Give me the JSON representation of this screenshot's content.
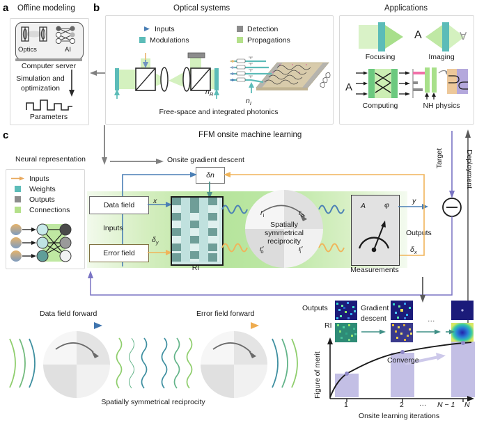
{
  "panels": {
    "a": {
      "letter": "a",
      "title": "Offline modeling",
      "optics_label": "Optics",
      "ai_label": "AI",
      "server_label": "Computer server",
      "sim_line1": "Simulation and",
      "sim_line2": "optimization",
      "parameters_label": "Parameters"
    },
    "b": {
      "letter": "b",
      "title": "Optical systems",
      "legend": [
        {
          "name": "inputs",
          "label": "Inputs",
          "icon": "arrow",
          "color": "#5a7fb0"
        },
        {
          "name": "modulations",
          "label": "Modulations",
          "icon": "square",
          "color": "#5cbcb8"
        },
        {
          "name": "detection",
          "label": "Detection",
          "icon": "square",
          "color": "#8c8c8c"
        },
        {
          "name": "propagations",
          "label": "Propagations",
          "icon": "square",
          "color": "#b4e08a"
        }
      ],
      "caption": "Free-space and integrated photonics",
      "n_R": "n",
      "n_R_sub": "R",
      "n_I": "n",
      "n_I_sub": "I"
    },
    "applications": {
      "title": "Applications",
      "items": [
        {
          "name": "focusing",
          "label": "Focusing"
        },
        {
          "name": "imaging",
          "label": "Imaging",
          "letter_in": "A",
          "letter_out": "∀"
        },
        {
          "name": "computing",
          "label": "Computing",
          "letter_in": "A"
        },
        {
          "name": "nh-physics",
          "label": "NH physics"
        }
      ]
    },
    "c": {
      "letter": "c",
      "title": "FFM onsite machine learning",
      "neural_title": "Neural representation",
      "neural_legend": [
        {
          "name": "inputs",
          "label": "Inputs",
          "icon": "arrow",
          "color": "#e8a85c"
        },
        {
          "name": "weights",
          "label": "Weights",
          "icon": "square",
          "color": "#5cbcb8"
        },
        {
          "name": "outputs",
          "label": "Outputs",
          "icon": "square",
          "color": "#8c8c8c"
        },
        {
          "name": "connections",
          "label": "Connections",
          "icon": "square",
          "color": "#b4e08a"
        }
      ],
      "onsite_gradient": "Onsite gradient descent",
      "delta_n": "δn",
      "data_field": "Data field",
      "error_field": "Error field",
      "inputs_label": "Inputs",
      "outputs_label": "Outputs",
      "sym_x": "x",
      "sym_dy": "δ",
      "sym_dy_sub": "y",
      "sym_y": "y",
      "sym_dx": "δ",
      "sym_dx_sub": "x",
      "ri_label": "RI",
      "reciprocity_line1": "Spatially",
      "reciprocity_line2": "symmetrical",
      "reciprocity_line3": "reciprocity",
      "r_i": "r",
      "r_i_sub": "i",
      "r_o": "r",
      "r_o_sub": "o",
      "rp_o": "r",
      "rp_o_sub": "o",
      "rp_i": "r",
      "rp_i_sub": "i",
      "measure_A": "A",
      "measure_phi": "φ",
      "measurements_label": "Measurements",
      "target_label": "Target",
      "deployment_label": "Deployment"
    },
    "reciprocity": {
      "data_forward": "Data field forward",
      "error_forward": "Error field forward",
      "caption": "Spatially symmetrical reciprocity"
    },
    "convergence": {
      "outputs_label": "Outputs",
      "ri_label": "RI",
      "gradient_line1": "Gradient",
      "gradient_line2": "descent",
      "converge_label": "Converge",
      "ellipsis": "···"
    }
  },
  "chart_data": {
    "type": "line",
    "title": "",
    "xlabel": "Onsite learning iterations",
    "ylabel": "Figure of merit",
    "x_tick_labels": [
      "1",
      "2",
      "···",
      "N − 1",
      "N"
    ],
    "x_tick_positions": [
      1,
      2,
      2.75,
      3.5,
      4
    ],
    "categories": [
      "1",
      "2",
      "N − 1",
      "N"
    ],
    "curve_x": [
      0,
      0.35,
      0.8,
      1.0,
      1.5,
      2.0,
      2.5,
      3.0,
      3.5,
      4.0
    ],
    "curve_y": [
      0,
      0.16,
      0.3,
      0.36,
      0.55,
      0.7,
      0.8,
      0.87,
      0.92,
      0.95
    ],
    "marker_points": [
      {
        "x": 1,
        "y": 0.36
      },
      {
        "x": 2,
        "y": 0.7
      },
      {
        "x": 4,
        "y": 0.95
      }
    ],
    "bar_x": [
      1,
      2,
      4
    ],
    "bar_tops": [
      0.36,
      0.7,
      0.95
    ],
    "ylim": [
      0,
      1
    ],
    "xlim": [
      0,
      4.35
    ],
    "grid": false,
    "legend": "none",
    "bar_color": "#b9b4e0",
    "curve_color": "#1a1a1a"
  },
  "colors": {
    "teal": "#5cbcb8",
    "green_light": "#b4e08a",
    "green_band": "#c9e9b0",
    "grey": "#8c8c8c",
    "blue_arrow": "#4a7fb5",
    "orange_arrow": "#f0b45a",
    "purple": "#7a74c4",
    "teal_dark": "#3f8f86",
    "ri_dark": "#6f9e98",
    "ri_light": "#cfe8e6"
  }
}
